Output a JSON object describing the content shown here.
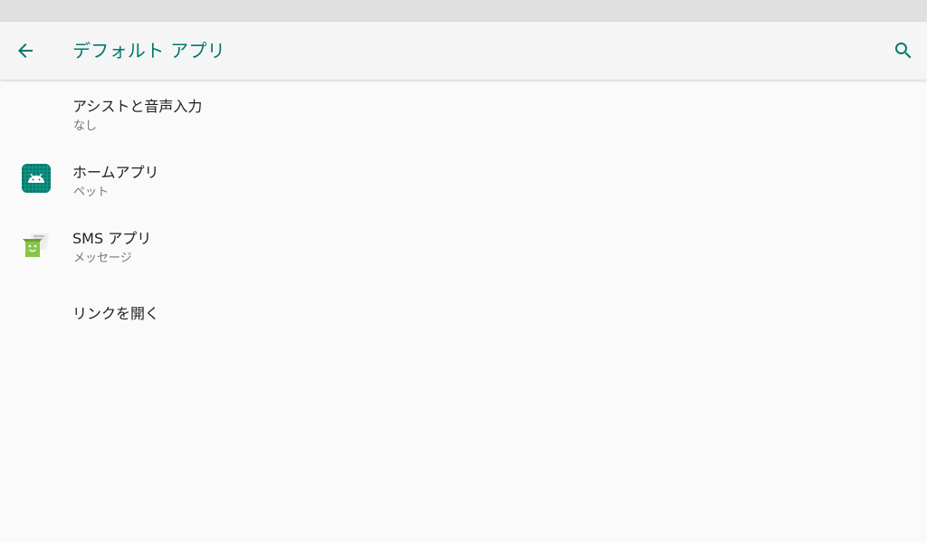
{
  "header": {
    "title": "デフォルト アプリ",
    "back_icon": "arrow-back-icon",
    "search_icon": "search-icon"
  },
  "colors": {
    "accent": "#00796b",
    "status_bar": "#e0e0e0",
    "app_bar": "#f5f5f5",
    "background": "#fafafa",
    "title_text": "#212121",
    "summary_text": "#757575"
  },
  "items": [
    {
      "title": "アシストと音声入力",
      "summary": "なし",
      "icon": ""
    },
    {
      "title": "ホームアプリ",
      "summary": "ペット",
      "icon": "android-app-icon"
    },
    {
      "title": "SMS アプリ",
      "summary": "メッセージ",
      "icon": "messaging-app-icon"
    },
    {
      "title": "リンクを開く",
      "summary": "",
      "icon": ""
    }
  ]
}
